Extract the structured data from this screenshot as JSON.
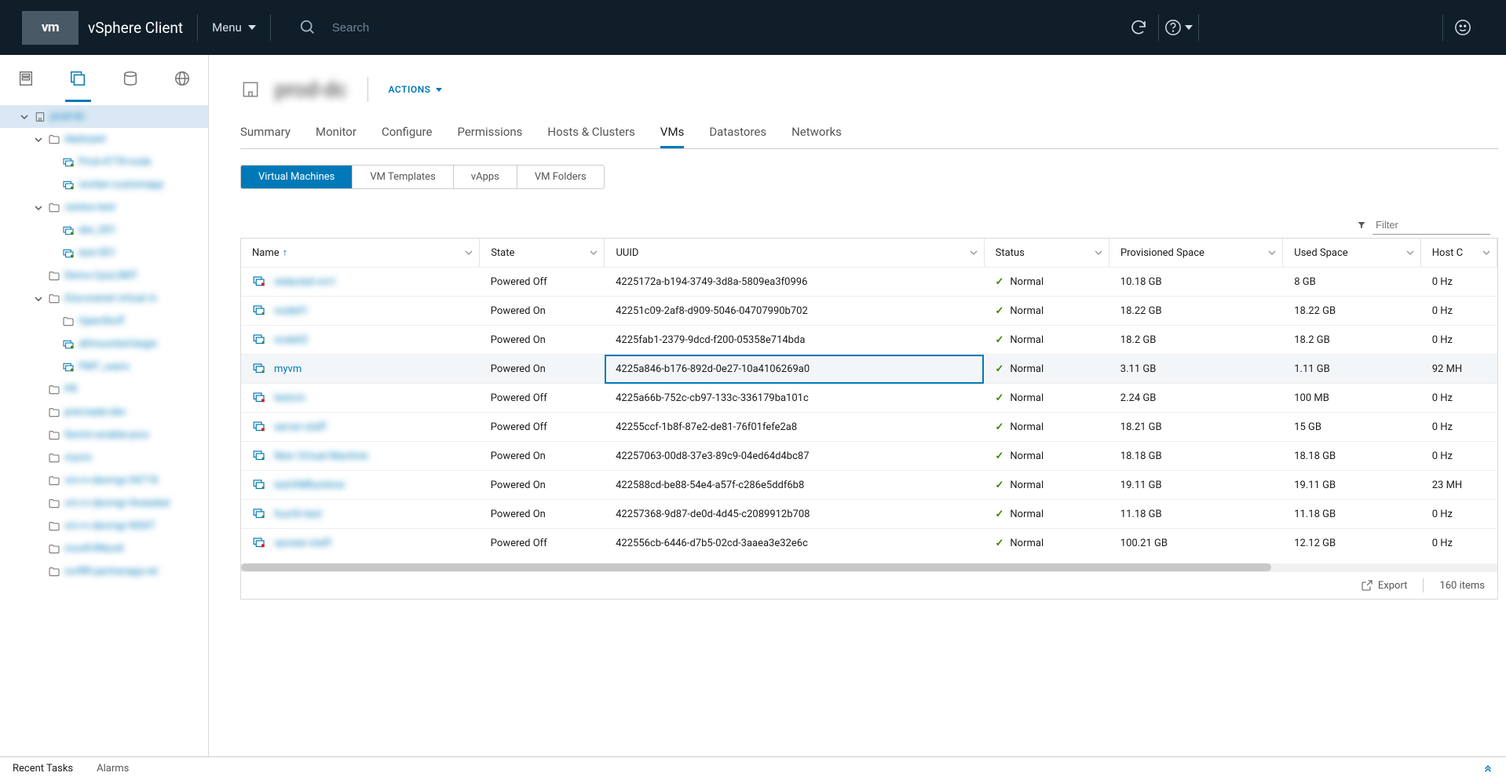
{
  "header": {
    "logo_text": "vm",
    "app_title": "vSphere Client",
    "menu_label": "Menu",
    "search_placeholder": "Search"
  },
  "sidebar": {
    "tree": [
      {
        "level": 1,
        "label": "prod-dc",
        "expanded": true,
        "selected": true,
        "icon": "datacenter"
      },
      {
        "level": 2,
        "label": "deployed",
        "expanded": true,
        "icon": "folder"
      },
      {
        "level": 3,
        "label": "Prod-4778-node",
        "icon": "vm",
        "state": "on"
      },
      {
        "level": 3,
        "label": "worker-customapp",
        "icon": "vm",
        "state": "on"
      },
      {
        "level": 2,
        "label": "centos-test",
        "expanded": true,
        "icon": "folder"
      },
      {
        "level": 3,
        "label": "dev_001",
        "icon": "vm",
        "state": "on"
      },
      {
        "level": 3,
        "label": "test-001",
        "icon": "vm",
        "state": "on"
      },
      {
        "level": 2,
        "label": "Demo-CpuLIMIT",
        "icon": "folder"
      },
      {
        "level": 2,
        "label": "Discovered virtual m",
        "expanded": true,
        "icon": "folder"
      },
      {
        "level": 3,
        "label": "OpenStuff",
        "icon": "folder"
      },
      {
        "level": 3,
        "label": "allmounted-begin",
        "icon": "vm",
        "state": "on"
      },
      {
        "level": 3,
        "label": "PMT_users",
        "icon": "vm",
        "state": "on"
      },
      {
        "level": 2,
        "label": "PR",
        "icon": "folder"
      },
      {
        "level": 2,
        "label": "precreate-dev",
        "icon": "folder"
      },
      {
        "level": 2,
        "label": "fenrim-enable-prov",
        "icon": "folder"
      },
      {
        "level": 2,
        "label": "myvm",
        "icon": "folder"
      },
      {
        "level": 2,
        "label": "vm-rv-devmgr-04718",
        "icon": "folder"
      },
      {
        "level": 2,
        "label": "vm-rv-devmgr-threaded",
        "icon": "folder"
      },
      {
        "level": 2,
        "label": "vm-rv-devmgr-NSXT",
        "icon": "folder"
      },
      {
        "level": 2,
        "label": "rnovR-RNovK",
        "icon": "folder"
      },
      {
        "level": 2,
        "label": "ovrRR-partnerapp-rel",
        "icon": "folder"
      }
    ]
  },
  "content": {
    "title": "prod-dc",
    "actions_label": "ACTIONS",
    "tabs": [
      "Summary",
      "Monitor",
      "Configure",
      "Permissions",
      "Hosts & Clusters",
      "VMs",
      "Datastores",
      "Networks"
    ],
    "active_tab": "VMs",
    "subtabs": [
      "Virtual Machines",
      "VM Templates",
      "vApps",
      "VM Folders"
    ],
    "active_subtab": "Virtual Machines",
    "filter_placeholder": "Filter"
  },
  "table": {
    "columns": [
      "Name",
      "State",
      "UUID",
      "Status",
      "Provisioned Space",
      "Used Space",
      "Host C"
    ],
    "sort_col": "Name",
    "rows": [
      {
        "name": "redacted-vm1",
        "state": "Powered Off",
        "uuid": "4225172a-b194-3749-3d8a-5809ea3f0996",
        "status": "Normal",
        "prov": "10.18 GB",
        "used": "8 GB",
        "host_cpu": "0 Hz",
        "blur": true
      },
      {
        "name": "node01",
        "state": "Powered On",
        "uuid": "42251c09-2af8-d909-5046-04707990b702",
        "status": "Normal",
        "prov": "18.22 GB",
        "used": "18.22 GB",
        "host_cpu": "0 Hz",
        "blur": true
      },
      {
        "name": "node02",
        "state": "Powered On",
        "uuid": "4225fab1-2379-9dcd-f200-05358e714bda",
        "status": "Normal",
        "prov": "18.2 GB",
        "used": "18.2 GB",
        "host_cpu": "0 Hz",
        "blur": true
      },
      {
        "name": "myvm",
        "state": "Powered On",
        "uuid": "4225a846-b176-892d-0e27-10a4106269a0",
        "status": "Normal",
        "prov": "3.11 GB",
        "used": "1.11 GB",
        "host_cpu": "92 MH",
        "blur": false,
        "selected": true
      },
      {
        "name": "testvm",
        "state": "Powered Off",
        "uuid": "4225a66b-752c-cb97-133c-336179ba101c",
        "status": "Normal",
        "prov": "2.24 GB",
        "used": "100 MB",
        "host_cpu": "0 Hz",
        "blur": true
      },
      {
        "name": "server-staff",
        "state": "Powered Off",
        "uuid": "42255ccf-1b8f-87e2-de81-76f01fefe2a8",
        "status": "Normal",
        "prov": "18.21 GB",
        "used": "15 GB",
        "host_cpu": "0 Hz",
        "blur": true
      },
      {
        "name": "New Virtual Machine",
        "state": "Powered On",
        "uuid": "42257063-00d8-37e3-89c9-04ed64d4bc87",
        "status": "Normal",
        "prov": "18.18 GB",
        "used": "18.18 GB",
        "host_cpu": "0 Hz",
        "blur": true
      },
      {
        "name": "testVMRuntime",
        "state": "Powered On",
        "uuid": "422588cd-be88-54e4-a57f-c286e5ddf6b8",
        "status": "Normal",
        "prov": "19.11 GB",
        "used": "19.11 GB",
        "host_cpu": "23 MH",
        "blur": true
      },
      {
        "name": "fourth-test",
        "state": "Powered On",
        "uuid": "42257368-9d87-de0d-4d45-c2089912b708",
        "status": "Normal",
        "prov": "11.18 GB",
        "used": "11.18 GB",
        "host_cpu": "0 Hz",
        "blur": true
      },
      {
        "name": "vpower-staff",
        "state": "Powered Off",
        "uuid": "422556cb-6446-d7b5-02cd-3aaea3e32e6c",
        "status": "Normal",
        "prov": "100.21 GB",
        "used": "12.12 GB",
        "host_cpu": "0 Hz",
        "blur": true
      }
    ],
    "export_label": "Export",
    "item_count": "160 items"
  },
  "bottom": {
    "recent_tasks": "Recent Tasks",
    "alarms": "Alarms"
  }
}
